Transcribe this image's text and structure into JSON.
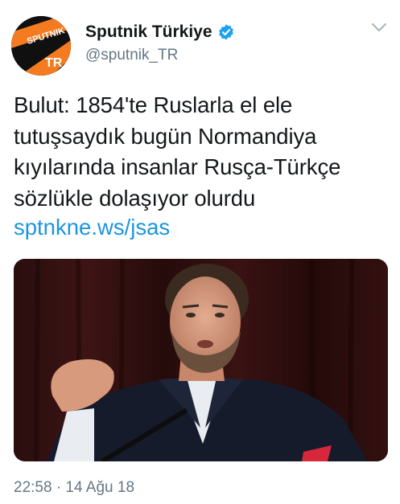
{
  "account": {
    "display_name": "Sputnik Türkiye",
    "handle": "@sputnik_TR",
    "verified": true,
    "avatar_logo_text": "SPUTNIK",
    "avatar_badge_text": "TR",
    "brand_color": "#f47b20"
  },
  "tweet": {
    "text_lines": [
      "Bulut: 1854'te Ruslarla el ele",
      "tutuşsaydık bugün Normandiya",
      "kıyılarında insanlar Rusça-Türkçe",
      "sözlükle dolaşıyor olurdu"
    ],
    "link": "sptnkne.ws/jsas",
    "timestamp": "22:58 · 14 Ağu 18"
  },
  "icons": {
    "verified": "verified-badge-icon",
    "menu": "chevron-down-icon"
  },
  "colors": {
    "text": "#14171a",
    "secondary": "#657786",
    "link": "#1b95e0",
    "verified": "#1da1f2"
  }
}
